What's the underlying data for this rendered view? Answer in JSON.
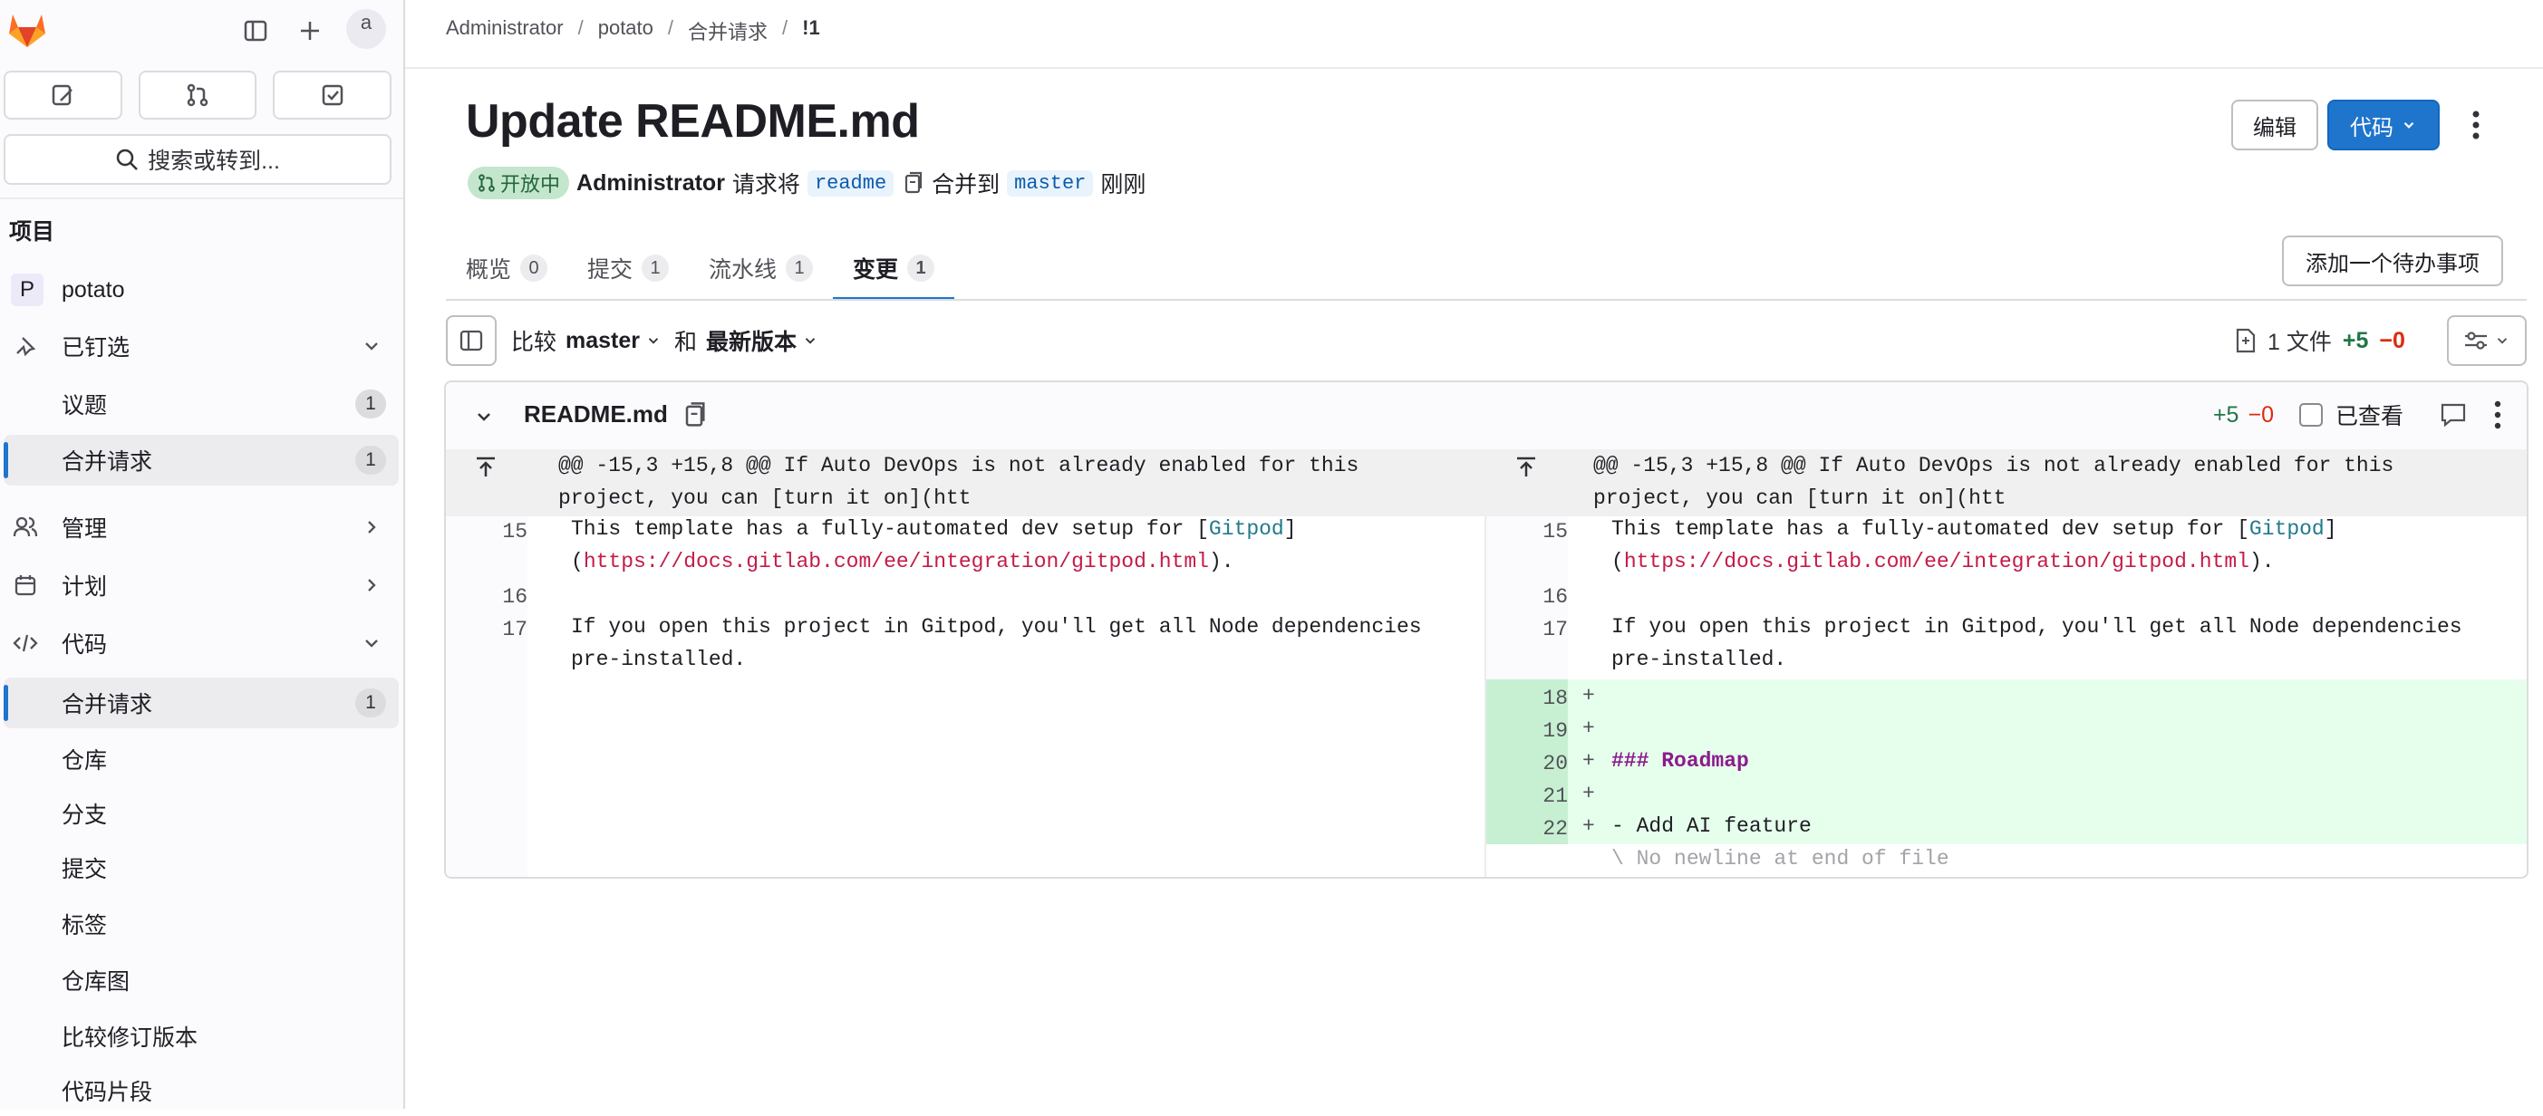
{
  "sidebar": {
    "avatar_alt": "a",
    "search_label": "搜索或转到...",
    "section_heading": "项目",
    "project_initial": "P",
    "project_name": "potato",
    "pinned": "已钉选",
    "pinned_items": [
      {
        "label": "议题",
        "count": "1"
      },
      {
        "label": "合并请求",
        "count": "1"
      }
    ],
    "manage": "管理",
    "plan": "计划",
    "code": "代码",
    "code_items": [
      {
        "label": "合并请求",
        "count": "1"
      },
      {
        "label": "仓库"
      },
      {
        "label": "分支"
      },
      {
        "label": "提交"
      },
      {
        "label": "标签"
      },
      {
        "label": "仓库图"
      },
      {
        "label": "比较修订版本"
      },
      {
        "label": "代码片段"
      }
    ]
  },
  "breadcrumb": [
    "Administrator",
    "potato",
    "合并请求",
    "!1"
  ],
  "mr": {
    "title": "Update README.md",
    "status": "开放中",
    "author": "Administrator",
    "requests_text": "请求将",
    "source_branch": "readme",
    "merge_into": "合并到",
    "target_branch": "master",
    "time": "刚刚",
    "edit_label": "编辑",
    "code_label": "代码",
    "todo_label": "添加一个待办事项"
  },
  "tabs": [
    {
      "label": "概览",
      "count": "0"
    },
    {
      "label": "提交",
      "count": "1"
    },
    {
      "label": "流水线",
      "count": "1"
    },
    {
      "label": "变更",
      "count": "1"
    }
  ],
  "compare": {
    "compare": "比较",
    "base": "master",
    "and": "和",
    "head": "最新版本",
    "files": "1 文件",
    "added": "+5",
    "removed": "−0"
  },
  "file": {
    "name": "README.md",
    "added": "+5",
    "removed": "−0",
    "viewed": "已查看",
    "hunk_line1": "@@ -15,3 +15,8 @@ If Auto DevOps is not already enabled for this",
    "hunk_line2": "project, you can [turn it on](htt",
    "line15_a": "This template has a fully-automated dev setup for [",
    "line15_b": "Gitpod",
    "line15_c": "]",
    "line15_d": "(",
    "line15_url": "https://docs.gitlab.com/ee/integration/gitpod.html",
    "line15_e": ").",
    "line17_a": "If you open this project in Gitpod, you'll get all Node dependencies",
    "line17_b": "pre-installed.",
    "line20": "### Roadmap",
    "line22": "- Add AI feature",
    "no_newline": "\\ No newline at end of file",
    "ln": {
      "15": "15",
      "16": "16",
      "17": "17",
      "18": "18",
      "19": "19",
      "20": "20",
      "21": "21",
      "22": "22"
    },
    "plus_marker": "+"
  },
  "colors": {
    "accent": "#1f75cb",
    "added_bg": "#e6ffed",
    "status_green": "#24663b"
  }
}
